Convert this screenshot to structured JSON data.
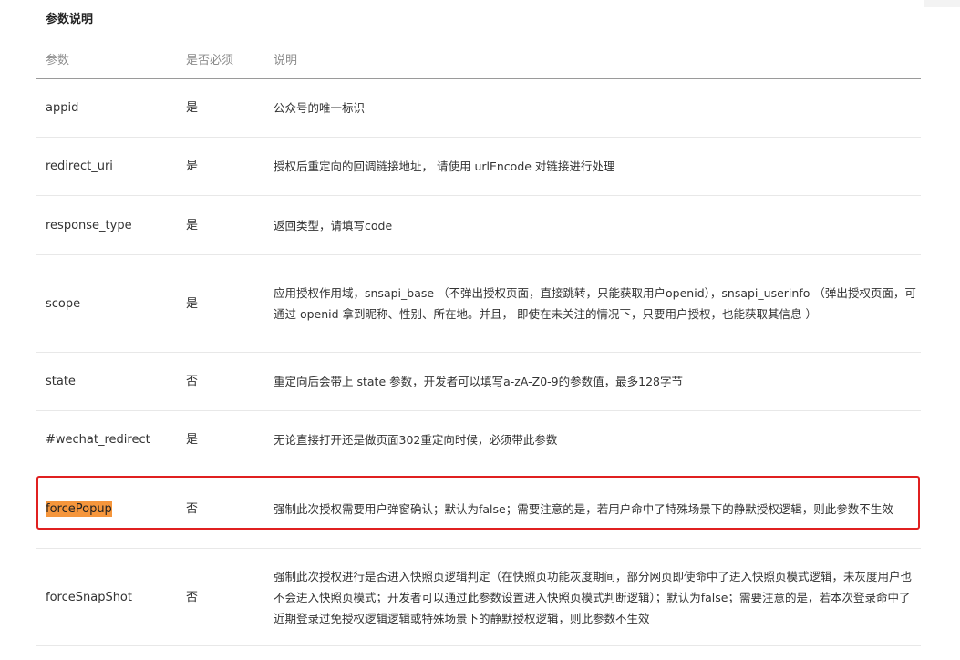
{
  "section_title": "参数说明",
  "table": {
    "headers": {
      "param": "参数",
      "required": "是否必须",
      "desc": "说明"
    },
    "rows": [
      {
        "param": "appid",
        "required": "是",
        "desc": "公众号的唯一标识"
      },
      {
        "param": "redirect_uri",
        "required": "是",
        "desc": "授权后重定向的回调链接地址， 请使用 urlEncode 对链接进行处理"
      },
      {
        "param": "response_type",
        "required": "是",
        "desc": "返回类型，请填写code"
      },
      {
        "param": "scope",
        "required": "是",
        "desc": "应用授权作用域，snsapi_base （不弹出授权页面，直接跳转，只能获取用户openid），snsapi_userinfo （弹出授权页面，可通过 openid 拿到昵称、性别、所在地。并且， 即使在未关注的情况下，只要用户授权，也能获取其信息 ）"
      },
      {
        "param": "state",
        "required": "否",
        "desc": "重定向后会带上 state 参数，开发者可以填写a-zA-Z0-9的参数值，最多128字节"
      },
      {
        "param": "#wechat_redirect",
        "required": "是",
        "desc": "无论直接打开还是做页面302重定向时候，必须带此参数"
      },
      {
        "param": "forcePopup",
        "required": "否",
        "desc": "强制此次授权需要用户弹窗确认；默认为false；需要注意的是，若用户命中了特殊场景下的静默授权逻辑，则此参数不生效"
      },
      {
        "param": "forceSnapShot",
        "required": "否",
        "desc": "强制此次授权进行是否进入快照页逻辑判定（在快照页功能灰度期间，部分网页即使命中了进入快照页模式逻辑，未灰度用户也不会进入快照页模式；开发者可以通过此参数设置进入快照页模式判断逻辑）；默认为false；需要注意的是，若本次登录命中了近期登录过免授权逻辑逻辑或特殊场景下的静默授权逻辑，则此参数不生效"
      }
    ]
  },
  "colors": {
    "highlight_fill": "#f5963c",
    "focus_border": "#e02020",
    "header_text": "#8c8c8c",
    "body_text": "#333333"
  }
}
